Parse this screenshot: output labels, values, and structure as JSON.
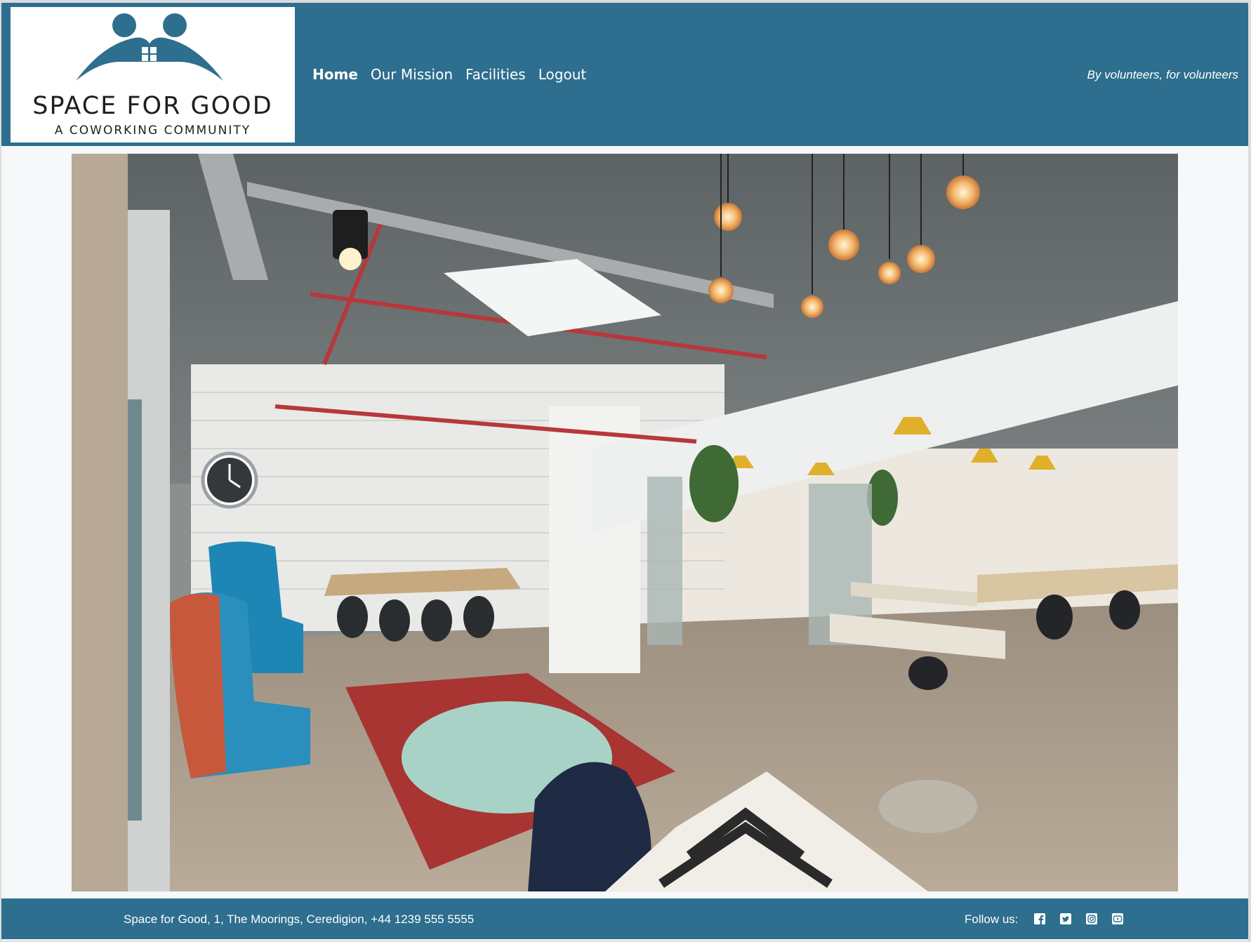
{
  "header": {
    "logo": {
      "title": "SPACE FOR GOOD",
      "subtitle": "A COWORKING COMMUNITY",
      "icon": "people-house-logo"
    },
    "nav": [
      {
        "label": "Home",
        "active": true
      },
      {
        "label": "Our Mission",
        "active": false
      },
      {
        "label": "Facilities",
        "active": false
      },
      {
        "label": "Logout",
        "active": false
      }
    ],
    "tagline": "By volunteers, for volunteers"
  },
  "hero": {
    "subject": "coworking-space-photo"
  },
  "footer": {
    "address": "Space for Good, 1, The Moorings, Ceredigion, +44 1239 555 5555",
    "follow_label": "Follow us:",
    "social": [
      "facebook-icon",
      "twitter-icon",
      "instagram-icon",
      "youtube-icon"
    ]
  },
  "colors": {
    "brand": "#2e6e8e",
    "page_background": "#f6f8fa",
    "text_on_brand": "#ffffff"
  }
}
